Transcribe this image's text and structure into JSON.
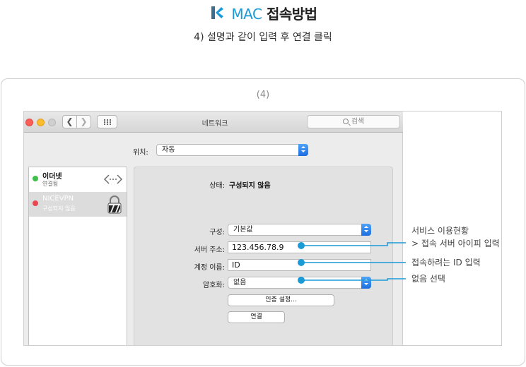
{
  "header": {
    "brand": "MAC",
    "title_rest": "접속방법",
    "subtitle": "4) 설명과 같이 입력 후 연결 클릭"
  },
  "step_label": "(4)",
  "window": {
    "title": "네트워크",
    "search_placeholder": "검색",
    "back_glyph": "❮",
    "forward_glyph": "❯",
    "location_label": "위치:",
    "location_value": "자동"
  },
  "sidebar": {
    "items": [
      {
        "name": "이더넷",
        "status": "연결됨",
        "dot_color": "#3fc04a"
      },
      {
        "name": "NICEVPN",
        "status": "구성되지 않음",
        "dot_color": "#e8474b"
      }
    ]
  },
  "panel": {
    "status_label": "상태:",
    "status_value": "구성되지 않음",
    "config_label": "구성:",
    "config_value": "기본값",
    "server_label": "서버 주소:",
    "server_value": "123.456.78.9",
    "account_label": "계정 이름:",
    "account_value": "ID",
    "encryption_label": "암호화:",
    "encryption_value": "없음",
    "auth_button": "인증 설정...",
    "connect_button": "연결"
  },
  "annotations": {
    "server_line1": "서비스 이용현황",
    "server_line2": "> 접속 서버 아이피 입력",
    "account": "접속하려는 ID 입력",
    "encryption": "없음 선택",
    "accent_color": "#1a9ad6"
  }
}
